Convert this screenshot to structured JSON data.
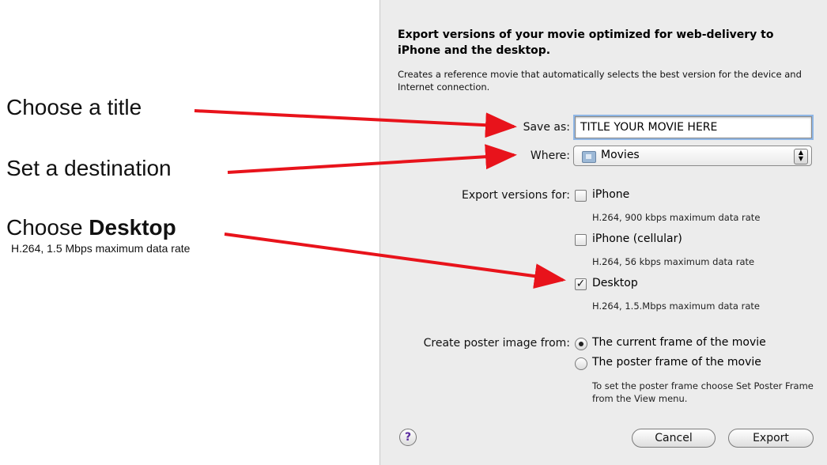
{
  "annotations": {
    "title": "Choose a title",
    "destination": "Set a destination",
    "desktop_prefix": "Choose ",
    "desktop_bold": "Desktop",
    "desktop_sub": "H.264, 1.5 Mbps maximum data rate"
  },
  "dialog": {
    "heading": "Export versions of your movie optimized for web-delivery to iPhone and the desktop.",
    "description": "Creates a reference movie that automatically selects the best version for the device and Internet connection.",
    "save_as_label": "Save as:",
    "save_as_value": "TITLE YOUR MOVIE HERE",
    "where_label": "Where:",
    "where_value": "Movies",
    "export_versions_label": "Export versions for:",
    "options": [
      {
        "label": "iPhone",
        "sub": "H.264, 900 kbps maximum data rate",
        "checked": false
      },
      {
        "label": "iPhone (cellular)",
        "sub": "H.264, 56 kbps maximum data rate",
        "checked": false
      },
      {
        "label": "Desktop",
        "sub": "H.264, 1.5.Mbps maximum data rate",
        "checked": true
      }
    ],
    "poster_label": "Create poster image from:",
    "poster_options": [
      {
        "label": "The current frame of the movie",
        "selected": true
      },
      {
        "label": "The poster frame of the movie",
        "selected": false
      }
    ],
    "poster_hint": "To set the poster frame choose Set Poster Frame from the View menu.",
    "help": "?",
    "cancel": "Cancel",
    "export": "Export"
  },
  "colors": {
    "arrow": "#e8131b",
    "dialog_bg": "#ececec"
  }
}
